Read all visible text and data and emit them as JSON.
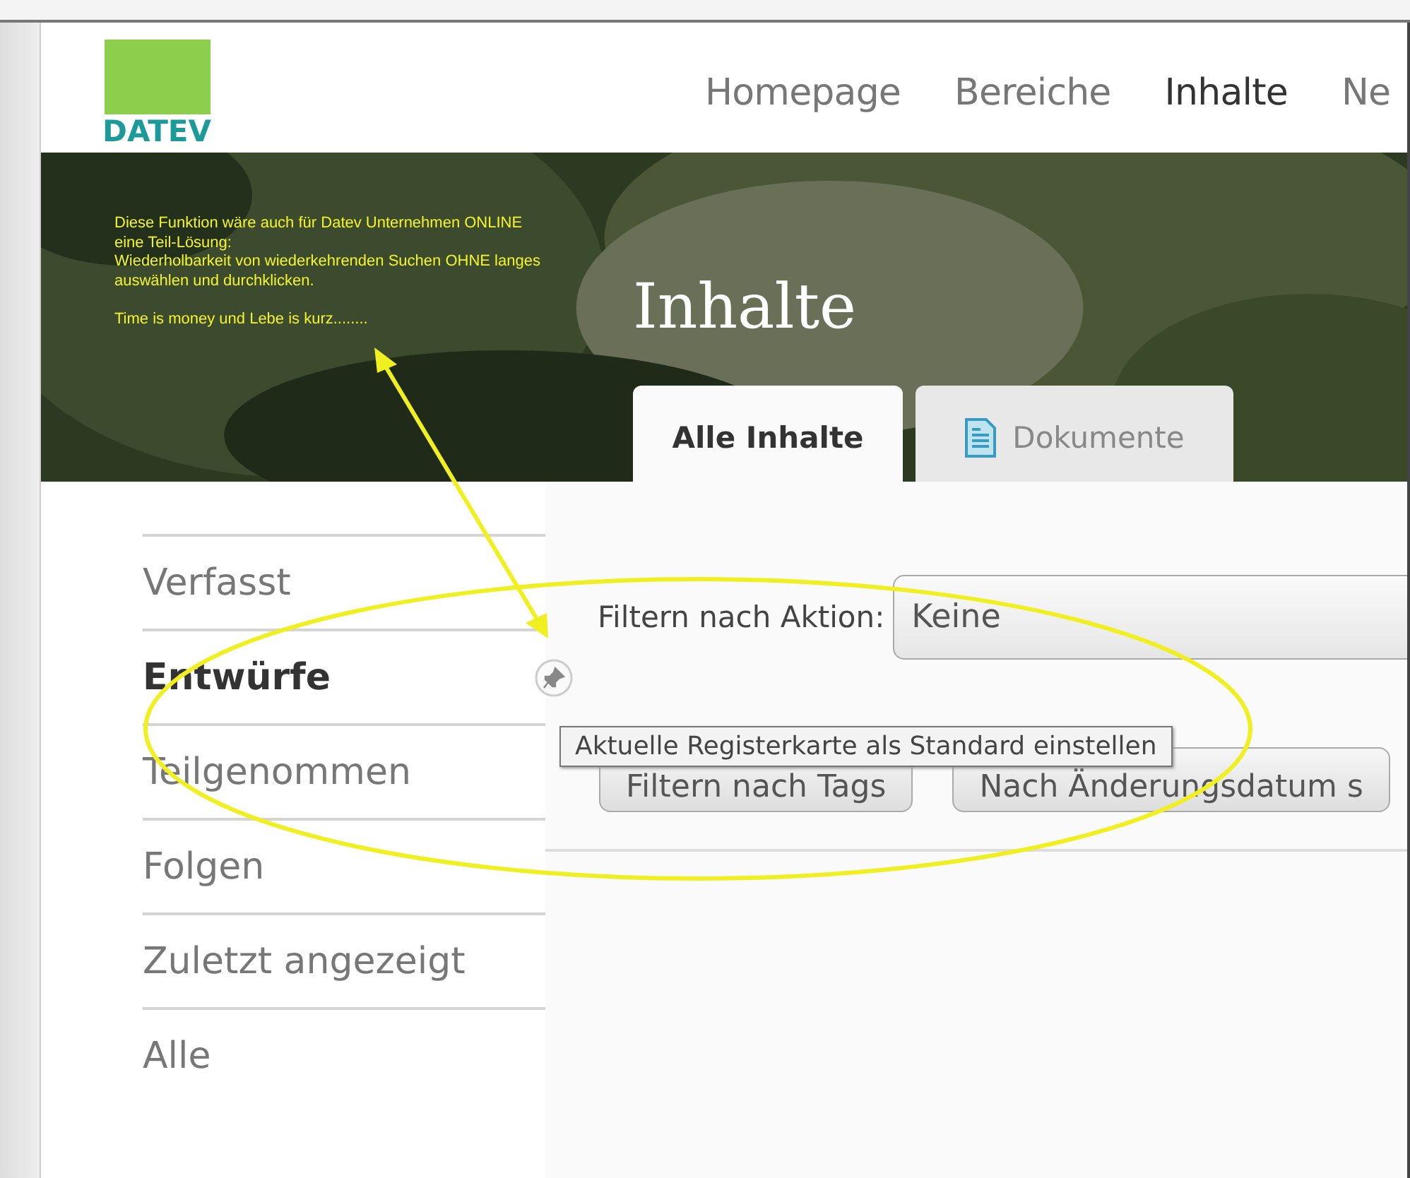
{
  "header": {
    "logo": "DATEV",
    "nav": [
      {
        "label": "Homepage",
        "selected": false
      },
      {
        "label": "Bereiche",
        "selected": false
      },
      {
        "label": "Inhalte",
        "selected": true
      },
      {
        "label": "Ne",
        "selected": false
      }
    ]
  },
  "hero": {
    "title": "Inhalte",
    "tabs": [
      {
        "label": "Alle Inhalte",
        "selected": true,
        "kind": "plain"
      },
      {
        "label": "Dokumente",
        "selected": false,
        "kind": "document"
      }
    ]
  },
  "sidebar": {
    "items": [
      {
        "label": "Verfasst",
        "selected": false
      },
      {
        "label": "Entwürfe",
        "selected": true
      },
      {
        "label": "Teilgenommen",
        "selected": false
      },
      {
        "label": "Folgen",
        "selected": false
      },
      {
        "label": "Zuletzt angezeigt",
        "selected": false
      },
      {
        "label": "Alle",
        "selected": false
      }
    ]
  },
  "filters": {
    "action_label": "Filtern nach Aktion:",
    "action_value": "Keine",
    "buttons": [
      "Filtern nach Tags",
      "Nach Änderungsdatum s"
    ]
  },
  "pin_tooltip": "Aktuelle Registerkarte als Standard einstellen",
  "annotation": {
    "lines": [
      "Diese Funktion wäre auch für Datev Unternehmen ONLINE",
      "eine Teil-Lösung:",
      "Wiederholbarkeit von wiederkehrenden Suchen OHNE langes",
      "auswählen und durchklicken."
    ],
    "closing": "Time is money und Lebe is kurz........"
  }
}
